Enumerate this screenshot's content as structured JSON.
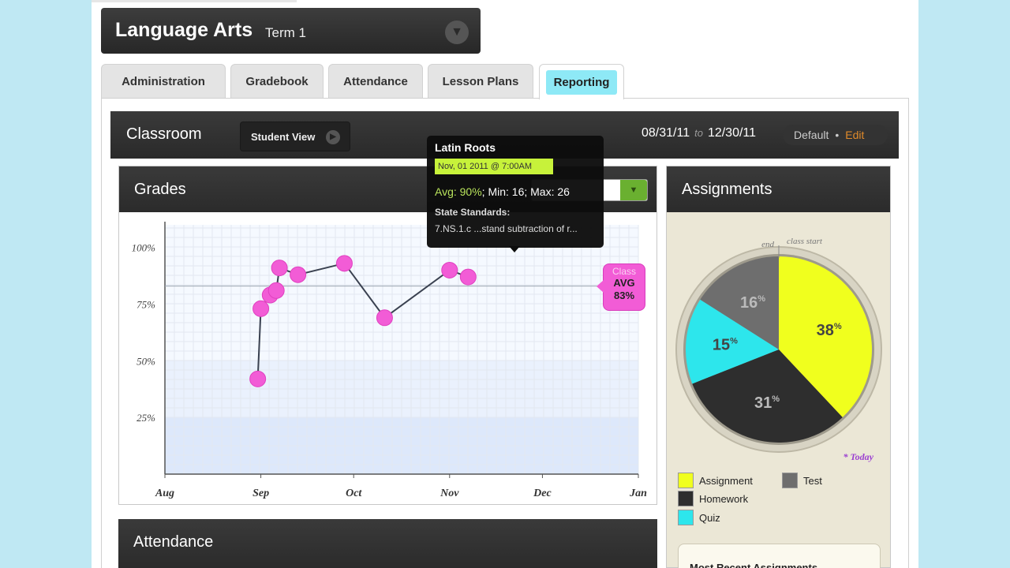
{
  "course": {
    "title": "Language Arts",
    "term": "Term 1"
  },
  "tabs": [
    {
      "label": "Administration"
    },
    {
      "label": "Gradebook"
    },
    {
      "label": "Attendance"
    },
    {
      "label": "Lesson Plans"
    },
    {
      "label": "Reporting",
      "active": true
    }
  ],
  "classroom": {
    "title": "Classroom",
    "student_view_label": "Student View",
    "date_from": "08/31/11",
    "date_to_word": "to",
    "date_to": "12/30/11",
    "view_name": "Default",
    "separator": "•",
    "edit_label": "Edit"
  },
  "grades_panel": {
    "title": "Grades"
  },
  "tooltip": {
    "title": "Latin Roots",
    "date": "Nov, 01 2011 @ 7:00AM",
    "avg": "Avg: 90%",
    "min_max": "; Min: 16; Max: 26",
    "standards_label": "State Standards:",
    "standards_text": "7.NS.1.c ...stand subtraction of r..."
  },
  "class_avg": {
    "label": "Class",
    "word": "AVG",
    "value": "83%"
  },
  "chart_data": {
    "type": "scatter",
    "title": "",
    "xlabel": "",
    "ylabel": "",
    "x_ticks": [
      "Aug",
      "Sep",
      "Oct",
      "Nov",
      "Dec",
      "Jan"
    ],
    "y_ticks": [
      "25%",
      "50%",
      "75%",
      "100%"
    ],
    "ylim": [
      0,
      110
    ],
    "series": [
      {
        "values": [
          {
            "x": "2011-08-31",
            "y": 42
          },
          {
            "x": "2011-09-01",
            "y": 73
          },
          {
            "x": "2011-09-04",
            "y": 79
          },
          {
            "x": "2011-09-06",
            "y": 81
          },
          {
            "x": "2011-09-07",
            "y": 91
          },
          {
            "x": "2011-09-13",
            "y": 88
          },
          {
            "x": "2011-09-28",
            "y": 93
          },
          {
            "x": "2011-10-11",
            "y": 69
          },
          {
            "x": "2011-11-01",
            "y": 90
          },
          {
            "x": "2011-11-07",
            "y": 87
          }
        ]
      }
    ],
    "class_average": 83,
    "grid": true,
    "point_color": "#f25cd6"
  },
  "assignments_panel": {
    "title": "Assignments",
    "end_label": "end",
    "start_label": "class start",
    "today_label": "* Today",
    "recent_title": "Most Recent Assignments"
  },
  "pie_data": {
    "type": "pie",
    "slices": [
      {
        "name": "Assignment",
        "value": 38,
        "color": "#f0ff1e"
      },
      {
        "name": "Homework",
        "value": 31,
        "color": "#2e2e2e"
      },
      {
        "name": "Quiz",
        "value": 15,
        "color": "#2de6ec"
      },
      {
        "name": "Test",
        "value": 16,
        "color": "#6e6e6e"
      }
    ],
    "percent_sign": "%"
  },
  "attendance_panel": {
    "title": "Attendance"
  }
}
